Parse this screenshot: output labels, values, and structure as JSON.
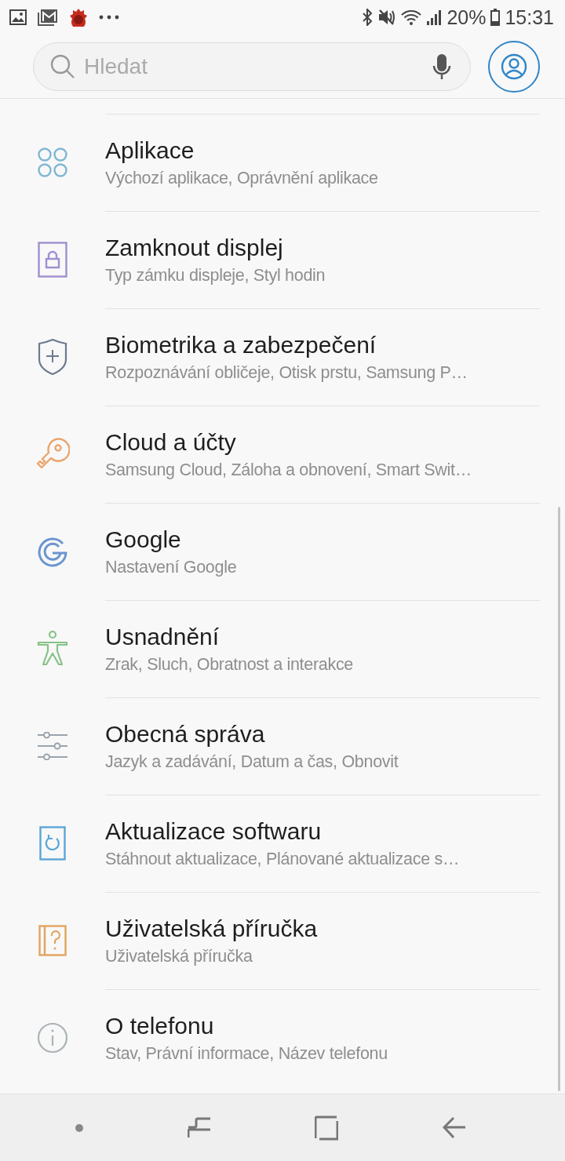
{
  "status_bar": {
    "battery": "20%",
    "time": "15:31"
  },
  "search": {
    "placeholder": "Hledat"
  },
  "items": [
    {
      "title": "Aplikace",
      "subtitle": "Výchozí aplikace, Oprávnění aplikace"
    },
    {
      "title": "Zamknout displej",
      "subtitle": "Typ zámku displeje, Styl hodin"
    },
    {
      "title": "Biometrika a zabezpečení",
      "subtitle": "Rozpoznávání obličeje, Otisk prstu, Samsung P…"
    },
    {
      "title": "Cloud a účty",
      "subtitle": "Samsung Cloud, Záloha a obnovení, Smart Swit…"
    },
    {
      "title": "Google",
      "subtitle": "Nastavení Google"
    },
    {
      "title": "Usnadnění",
      "subtitle": "Zrak, Sluch, Obratnost a interakce"
    },
    {
      "title": "Obecná správa",
      "subtitle": "Jazyk a zadávání, Datum a čas, Obnovit"
    },
    {
      "title": "Aktualizace softwaru",
      "subtitle": "Stáhnout aktualizace, Plánované aktualizace s…"
    },
    {
      "title": "Uživatelská příručka",
      "subtitle": "Uživatelská příručka"
    },
    {
      "title": "O telefonu",
      "subtitle": "Stav, Právní informace, Název telefonu"
    }
  ]
}
